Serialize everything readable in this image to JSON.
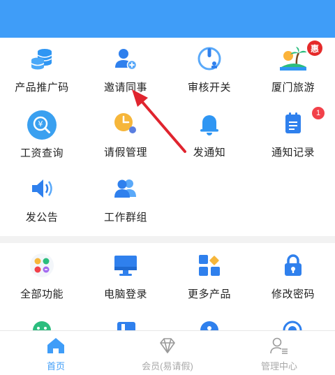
{
  "colors": {
    "header": "#3f9df8",
    "accent": "#3f9df8",
    "badge": "#e52a2a",
    "arrow": "#e0242e"
  },
  "section1": {
    "items": [
      {
        "label": "产品推广码",
        "icon": "coin-stack-icon"
      },
      {
        "label": "邀请同事",
        "icon": "add-user-icon"
      },
      {
        "label": "审核开关",
        "icon": "power-switch-icon"
      },
      {
        "label": "厦门旅游",
        "icon": "island-icon",
        "badge": "惠"
      },
      {
        "label": "工资查询",
        "icon": "salary-search-icon"
      },
      {
        "label": "请假管理",
        "icon": "leave-clock-icon"
      },
      {
        "label": "发通知",
        "icon": "bell-icon"
      },
      {
        "label": "通知记录",
        "icon": "notice-record-icon",
        "badge": "1"
      },
      {
        "label": "发公告",
        "icon": "speaker-icon"
      },
      {
        "label": "工作群组",
        "icon": "group-icon"
      }
    ]
  },
  "section2": {
    "items": [
      {
        "label": "全部功能",
        "icon": "all-functions-icon"
      },
      {
        "label": "电脑登录",
        "icon": "computer-icon"
      },
      {
        "label": "更多产品",
        "icon": "more-products-icon"
      },
      {
        "label": "修改密码",
        "icon": "lock-icon"
      }
    ]
  },
  "tabbar": {
    "tabs": [
      {
        "label": "首页",
        "icon": "home-icon",
        "active": true
      },
      {
        "label": "会员(易请假)",
        "icon": "diamond-icon",
        "active": false
      },
      {
        "label": "管理中心",
        "icon": "admin-user-icon",
        "active": false
      }
    ]
  }
}
